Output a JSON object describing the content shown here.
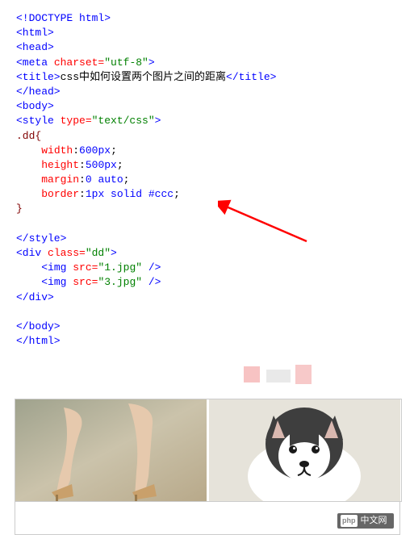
{
  "code": {
    "l1_a": "<!DOCTYPE html>",
    "l2_a": "<html>",
    "l3_a": "<head>",
    "l4_a": "<meta",
    "l4_b": " charset=",
    "l4_c": "\"utf-8\"",
    "l4_d": ">",
    "l5_a": "<title>",
    "l5_b": "css中如何设置两个图片之间的距离",
    "l5_c": "</title>",
    "l6_a": "</head>",
    "l7_a": "<body>",
    "l8_a": "<style",
    "l8_b": " type=",
    "l8_c": "\"text/css\"",
    "l8_d": ">",
    "l9_a": ".dd",
    "l9_b": "{",
    "l10_a": "width",
    "l10_b": ":",
    "l10_c": "600px",
    "l10_d": ";",
    "l11_a": "height",
    "l11_b": ":",
    "l11_c": "500px",
    "l11_d": ";",
    "l12_a": "margin",
    "l12_b": ":",
    "l12_c": "0 auto",
    "l12_d": ";",
    "l13_a": "border",
    "l13_b": ":",
    "l13_c": "1px solid #ccc",
    "l13_d": ";",
    "l14_a": "}",
    "l16_a": "</style>",
    "l17_a": "<div",
    "l17_b": " class=",
    "l17_c": "\"dd\"",
    "l17_d": ">",
    "l18_a": "<img",
    "l18_b": " src=",
    "l18_c": "\"1.jpg\"",
    "l18_d": " />",
    "l19_a": "<img",
    "l19_b": " src=",
    "l19_c": "\"3.jpg\"",
    "l19_d": " />",
    "l20_a": "</div>",
    "l22_a": "</body>",
    "l23_a": "</html>"
  },
  "pixel_colors": [
    "#f7c3c3",
    "#e9e9e9",
    "#f7c9c9"
  ],
  "watermark_text": "中文网",
  "watermark_logo": "php"
}
